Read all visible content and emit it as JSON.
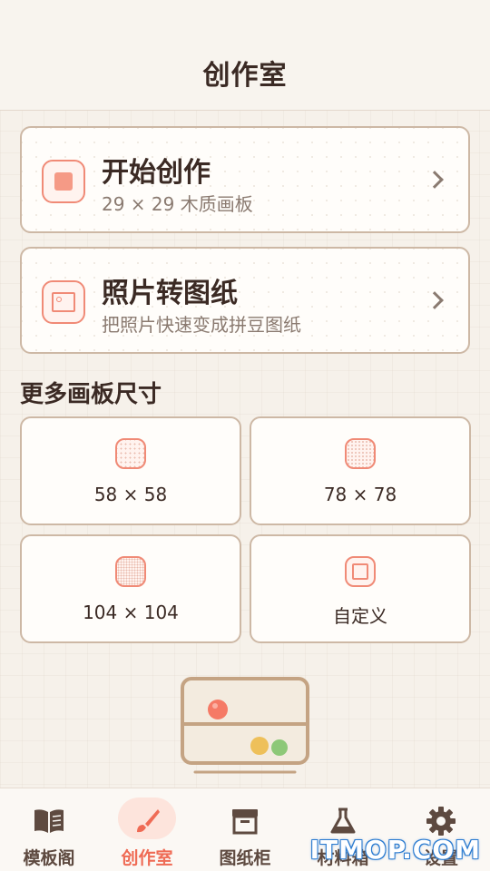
{
  "header": {
    "title": "创作室"
  },
  "cards": [
    {
      "title": "开始创作",
      "subtitle": "29 × 29 木质画板"
    },
    {
      "title": "照片转图纸",
      "subtitle": "把照片快速变成拼豆图纸"
    }
  ],
  "sizes": {
    "title": "更多画板尺寸",
    "items": [
      {
        "label": "58 × 58"
      },
      {
        "label": "78 × 78"
      },
      {
        "label": "104 × 104"
      },
      {
        "label": "自定义"
      }
    ]
  },
  "nav": {
    "items": [
      {
        "label": "模板阁",
        "icon": "book-icon"
      },
      {
        "label": "创作室",
        "icon": "brush-icon",
        "active": true
      },
      {
        "label": "图纸柜",
        "icon": "archive-icon"
      },
      {
        "label": "材料箱",
        "icon": "flask-icon"
      },
      {
        "label": "设置",
        "icon": "gear-icon"
      }
    ]
  },
  "colors": {
    "accent": "#ef6b55",
    "background": "#f6f1ea",
    "card_border": "#cdb8a5"
  },
  "watermark": "ITMOP.COM"
}
